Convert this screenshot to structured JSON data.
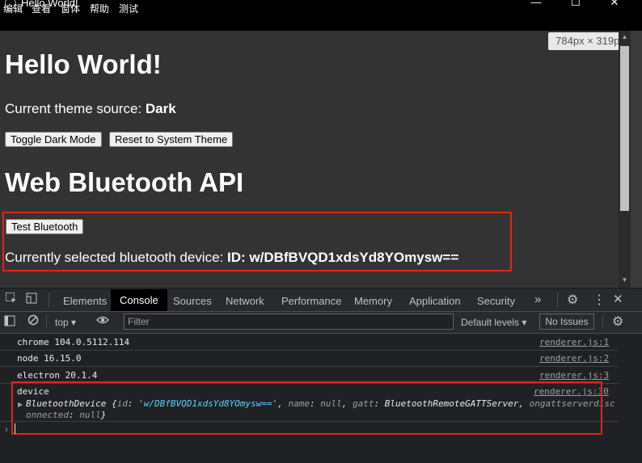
{
  "window": {
    "title": "Hello World!",
    "controls": {
      "minimize": "—",
      "maximize": "☐",
      "close": "✕"
    }
  },
  "menu": {
    "items": [
      "编辑",
      "查看",
      "窗体",
      "帮助",
      "测试"
    ]
  },
  "viewport_badge": "784px × 319px",
  "page": {
    "heading": "Hello World!",
    "theme_label": "Current theme source: ",
    "theme_value": "Dark",
    "toggle_button": "Toggle Dark Mode",
    "reset_button": "Reset to System Theme",
    "bt_heading": "Web Bluetooth API",
    "bt_button": "Test Bluetooth",
    "bt_device_label": "Currently selected bluetooth device: ",
    "bt_device_value": "ID: w/DBfBVQD1xdsYd8YOmysw=="
  },
  "devtools": {
    "tabs": [
      "Elements",
      "Console",
      "Sources",
      "Network",
      "Performance",
      "Memory",
      "Application",
      "Security"
    ],
    "active_tab": "Console",
    "more_tabs": "»",
    "context": "top",
    "filter_placeholder": "Filter",
    "levels": "Default levels",
    "issues": "No Issues",
    "logs": [
      {
        "text": "chrome 104.0.5112.114",
        "source": "renderer.js:1"
      },
      {
        "text": "node 16.15.0",
        "source": "renderer.js:2"
      },
      {
        "text": "electron 20.1.4",
        "source": "renderer.js:3"
      }
    ],
    "device_log": {
      "label": "device",
      "source": "renderer.js:30",
      "obj_name": "BluetoothDevice",
      "id_key": "id",
      "id_val": "'w/DBfBVQD1xdsYd8YOmysw=='",
      "name_key": "name",
      "name_val": "null",
      "gatt_key": "gatt",
      "gatt_val": "BluetoothRemoteGATTServer",
      "on_key": "ongattserverdisc",
      "on_key2": "onnected",
      "on_val": "null"
    }
  },
  "colors": {
    "highlight": "#e0251a",
    "string": "#5cd5fb",
    "page_bg": "#333333"
  }
}
